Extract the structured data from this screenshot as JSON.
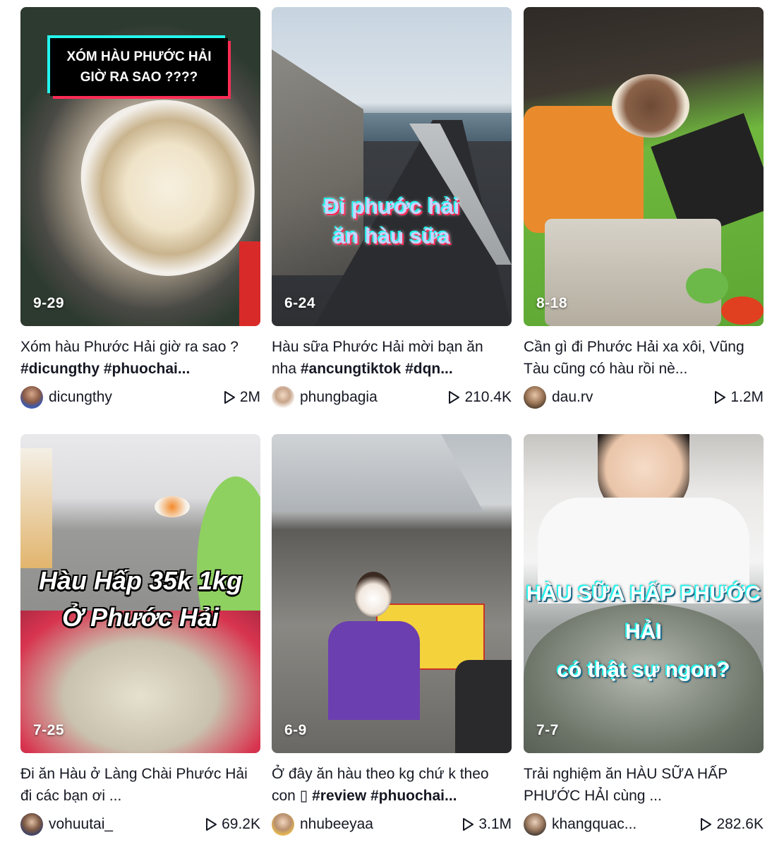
{
  "colors": {
    "text": "#161823",
    "overlay_white": "#ffffff",
    "tiktok_cyan": "#25F4EE",
    "tiktok_red": "#FE2C55"
  },
  "videos": [
    {
      "date": "9-29",
      "overlay": "XÓM HÀU PHƯỚC HẢI\nGIỜ RA SAO ????",
      "desc_text": "Xóm hàu Phước Hải giờ ra sao ? ",
      "desc_tags": "#dicungthy #phuochai...",
      "username": "dicungthy",
      "views": "2M",
      "play_icon": "play-icon"
    },
    {
      "date": "6-24",
      "overlay": "Đi phước hải\năn hàu sữa",
      "desc_text": "Hàu sữa Phước Hải mời bạn ăn nha ",
      "desc_tags": "#ancungtiktok #dqn...",
      "username": "phungbagia",
      "views": "210.4K",
      "play_icon": "play-icon"
    },
    {
      "date": "8-18",
      "overlay": "",
      "desc_text": "Cần gì đi Phước Hải xa xôi, Vũng Tàu cũng có hàu rồi nè...",
      "desc_tags": "",
      "username": "dau.rv",
      "views": "1.2M",
      "play_icon": "play-icon"
    },
    {
      "date": "7-25",
      "overlay": "Hàu Hấp 35k 1kg\nỞ Phước Hải",
      "desc_text": "Đi ăn Hàu ở Làng Chài Phước Hải đi các bạn ơi ...",
      "desc_tags": "",
      "username": "vohuutai_",
      "views": "69.2K",
      "play_icon": "play-icon"
    },
    {
      "date": "6-9",
      "overlay": "",
      "desc_text": "Ở đây ăn hàu theo kg chứ k theo con ▯ ",
      "desc_tags": "#review #phuochai...",
      "username": "nhubeeyaa",
      "views": "3.1M",
      "play_icon": "play-icon"
    },
    {
      "date": "7-7",
      "overlay": "HÀU SỮA HẤP PHƯỚC HẢI\ncó thật sự ngon?",
      "desc_text": "Trải nghiệm ăn HÀU SỮA HẤP PHƯỚC HẢI cùng ...",
      "desc_tags": "",
      "username": "khangquac...",
      "views": "282.6K",
      "play_icon": "play-icon"
    }
  ]
}
